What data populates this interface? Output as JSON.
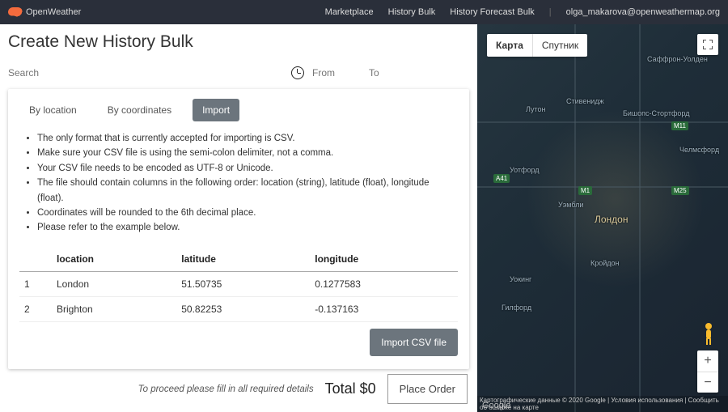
{
  "header": {
    "brand": "OpenWeather",
    "nav": [
      "Marketplace",
      "History Bulk",
      "History Forecast Bulk"
    ],
    "user_email": "olga_makarova@openweathermap.org"
  },
  "page": {
    "title": "Create New History Bulk",
    "search_placeholder": "Search",
    "from_placeholder": "From",
    "to_placeholder": "To"
  },
  "tabs": {
    "by_location": "By location",
    "by_coordinates": "By coordinates",
    "import": "Import"
  },
  "instructions": [
    "The only format that is currently accepted for importing is CSV.",
    "Make sure your CSV file is using the semi-colon delimiter, not a comma.",
    "Your CSV file needs to be encoded as UTF-8 or Unicode.",
    "The file should contain columns in the following order: location (string), latitude (float), longitude (float).",
    "Coordinates will be rounded to the 6th decimal place.",
    "Please refer to the example below."
  ],
  "table": {
    "headers": {
      "idx": "",
      "location": "location",
      "latitude": "latitude",
      "longitude": "longitude"
    },
    "rows": [
      {
        "idx": "1",
        "location": "London",
        "latitude": "51.50735",
        "longitude": "0.1277583"
      },
      {
        "idx": "2",
        "location": "Brighton",
        "latitude": "50.82253",
        "longitude": "-0.137163"
      }
    ]
  },
  "buttons": {
    "import_csv": "Import CSV file",
    "place_order": "Place Order"
  },
  "footer": {
    "proceed": "To proceed please fill in all required details",
    "total": "Total $0"
  },
  "map": {
    "controls": {
      "map": "Карта",
      "satellite": "Спутник"
    },
    "center_label": "Лондон",
    "places": [
      "Уотфорд",
      "Стивенидж",
      "Челмсфорд",
      "Бишопс-Стортфорд",
      "Лутон",
      "Уэмбли",
      "Кройдон",
      "Уокинг",
      "Гилфорд",
      "Саффрон-Уолден"
    ],
    "google": "Google",
    "attribution": "Картографические данные © 2020 Google | Условия использования | Сообщить об ошибке на карте"
  }
}
